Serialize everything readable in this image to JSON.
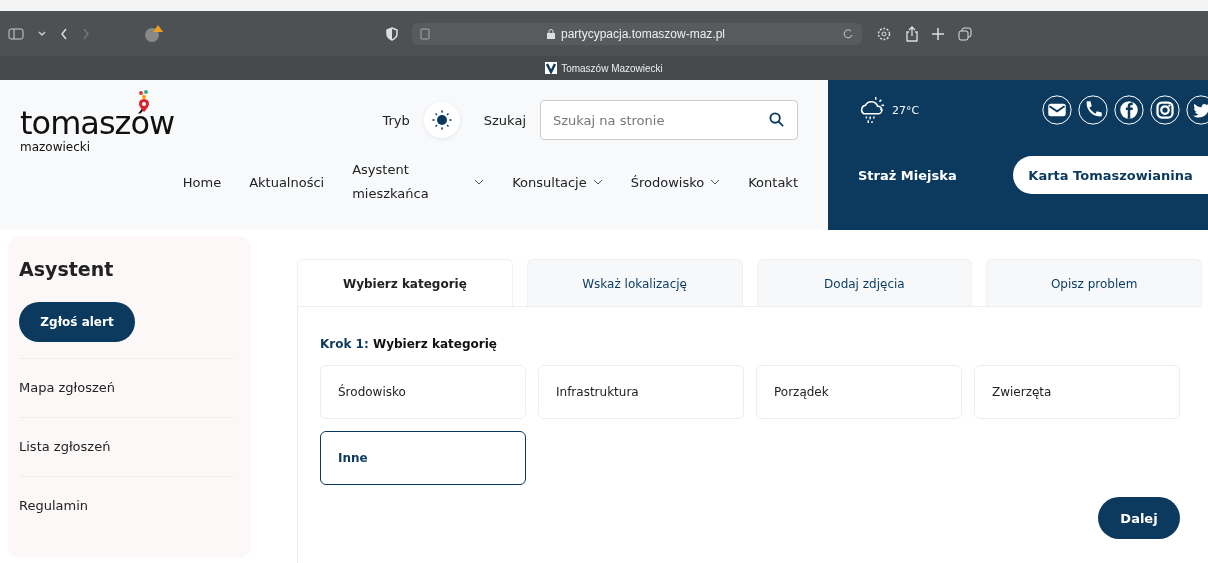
{
  "browser": {
    "url": "partycypacja.tomaszow-maz.pl",
    "bookmark": "Tomaszów Mazowiecki"
  },
  "header": {
    "logo": {
      "main": "tomaszów",
      "sub": "mazowiecki"
    },
    "mode_label": "Tryb",
    "search_label": "Szukaj",
    "search": {
      "placeholder": "Szukaj na stronie"
    },
    "nav": [
      {
        "label": "Home",
        "dropdown": false
      },
      {
        "label": "Aktualności",
        "dropdown": false
      },
      {
        "label": "Asystent mieszkańca",
        "dropdown": true
      },
      {
        "label": "Konsultacje",
        "dropdown": true
      },
      {
        "label": "Środowisko",
        "dropdown": true
      },
      {
        "label": "Kontakt",
        "dropdown": false
      }
    ],
    "weather": {
      "temperature": "27°C"
    },
    "social": [
      {
        "kind": "mail"
      },
      {
        "kind": "phone"
      },
      {
        "kind": "facebook"
      },
      {
        "kind": "instagram"
      },
      {
        "kind": "twitter"
      }
    ],
    "city_guard": "Straż Miejska",
    "card_button": "Karta Tomaszowianina"
  },
  "sidebar": {
    "title": "Asystent",
    "alert_button": "Zgłoś alert",
    "items": [
      "Mapa zgłoszeń",
      "Lista zgłoszeń",
      "Regulamin"
    ]
  },
  "tabs": [
    {
      "label": "Wybierz kategorię",
      "selected": true
    },
    {
      "label": "Wskaż lokalizację",
      "selected": false
    },
    {
      "label": "Dodaj zdjęcia",
      "selected": false
    },
    {
      "label": "Opisz problem",
      "selected": false
    }
  ],
  "step": {
    "prefix": "Krok 1:",
    "title": "Wybierz kategorię"
  },
  "categories": [
    {
      "label": "Środowisko",
      "selected": false
    },
    {
      "label": "Infrastruktura",
      "selected": false
    },
    {
      "label": "Porządek",
      "selected": false
    },
    {
      "label": "Zwierzęta",
      "selected": false
    },
    {
      "label": "Inne",
      "selected": true
    }
  ],
  "next_button": "Dalej"
}
